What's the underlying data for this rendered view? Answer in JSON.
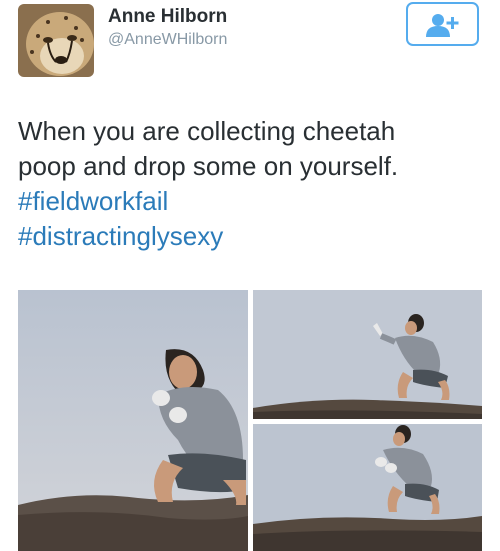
{
  "user": {
    "name": "Anne Hilborn",
    "handle": "@AnneWHilborn"
  },
  "follow_button": {
    "icon": "follow-user-plus-icon"
  },
  "tweet": {
    "text_lines": [
      "When you are collecting cheetah",
      "poop and drop some on yourself."
    ],
    "hashtags": [
      "#fieldworkfail",
      "#distractinglysexy"
    ]
  },
  "colors": {
    "accent": "#55acee",
    "hashtag": "#2b7bb9",
    "handle": "#8899a6",
    "text": "#292f33"
  }
}
